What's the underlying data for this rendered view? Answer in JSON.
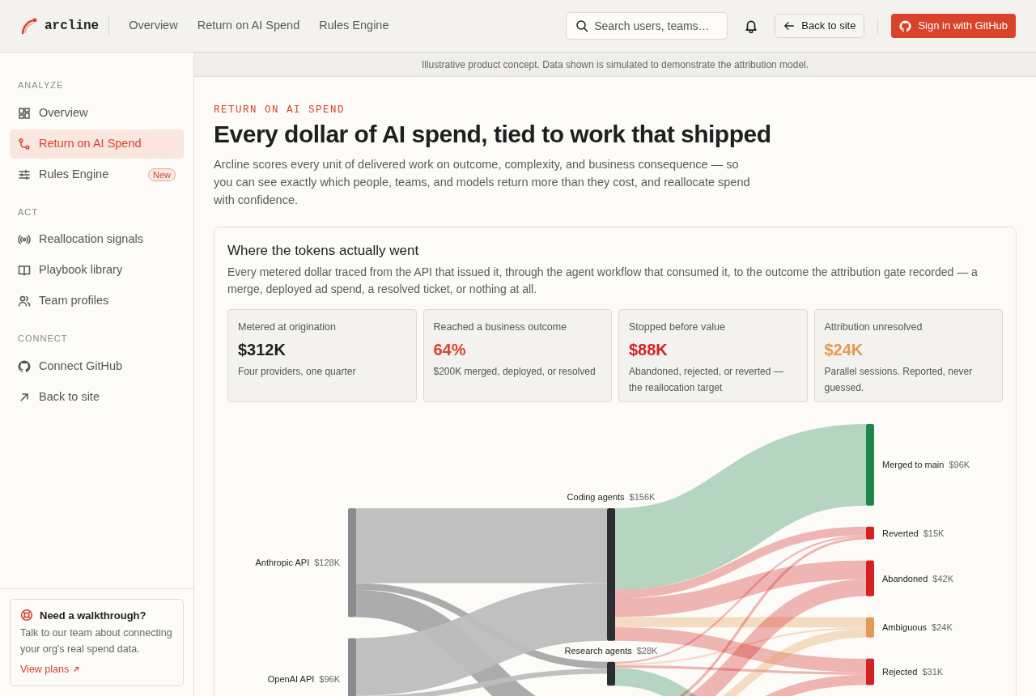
{
  "header": {
    "logo": "arcline",
    "nav": [
      {
        "label": "Overview",
        "selected": false
      },
      {
        "label": "Return on AI Spend",
        "selected": false
      },
      {
        "label": "Rules Engine",
        "selected": false
      }
    ],
    "search": {
      "placeholder": "Search users, teams…"
    },
    "back_button": "Back to site",
    "signin_button": "Sign in with GitHub"
  },
  "sidebar": {
    "sections": [
      {
        "heading": "ANALYZE",
        "items": [
          {
            "label": "Overview",
            "kind": "grid",
            "selected": false
          },
          {
            "label": "Return on AI Spend",
            "kind": "branch",
            "selected": true
          },
          {
            "label": "Rules Engine",
            "kind": "sliders",
            "selected": false,
            "badge": "New"
          }
        ]
      },
      {
        "heading": "ACT",
        "items": [
          {
            "label": "Reallocation signals",
            "kind": "signal",
            "selected": false
          },
          {
            "label": "Playbook library",
            "kind": "book",
            "selected": false
          },
          {
            "label": "Team profiles",
            "kind": "users",
            "selected": false
          }
        ]
      },
      {
        "heading": "CONNECT",
        "items": [
          {
            "label": "Connect GitHub",
            "kind": "github",
            "selected": false
          },
          {
            "label": "Back to site",
            "kind": "arrow",
            "selected": false
          }
        ]
      }
    ],
    "help": {
      "title": "Need a walkthrough?",
      "text": "Talk to our team about connecting your org's real spend data.",
      "link": "View plans"
    }
  },
  "notice": "Illustrative product concept. Data shown is simulated to demonstrate the attribution model.",
  "page": {
    "eyebrow": "RETURN ON AI SPEND",
    "title": "Every dollar of AI spend, tied to work that shipped",
    "lead": "Arcline scores every unit of delivered work on outcome, complexity, and business consequence — so you can see exactly which people, teams, and models return more than they cost, and reallocate spend with confidence."
  },
  "panel": {
    "title": "Where the tokens actually went",
    "description": "Every metered dollar traced from the API that issued it, through the agent workflow that consumed it, to the outcome the attribution gate recorded — a merge, deployed ad spend, a resolved ticket, or nothing at all.",
    "stats": [
      {
        "label": "Metered at origination",
        "value": "$312K",
        "note": "Four providers, one quarter",
        "color": "#1f1f1f"
      },
      {
        "label": "Reached a business outcome",
        "value": "64%",
        "note": "$200K merged, deployed, or resolved",
        "color": "#d9432a"
      },
      {
        "label": "Stopped before value",
        "value": "$88K",
        "note": "Abandoned, rejected, or reverted — the reallocation target",
        "color": "#d42222"
      },
      {
        "label": "Attribution unresolved",
        "value": "$24K",
        "note": "Parallel sessions. Reported, never guessed.",
        "color": "#e39a52"
      }
    ],
    "sankey": {
      "columns": [
        {
          "nodes": [
            {
              "label": "Anthropic API",
              "value": "$128K",
              "color": "#8a8a90"
            },
            {
              "label": "OpenAI API",
              "value": "$96K",
              "color": "#8a8a90"
            }
          ]
        },
        {
          "nodes": [
            {
              "label": "Coding agents",
              "value": "$156K",
              "color": "#2d2e33"
            },
            {
              "label": "Research agents",
              "value": "$28K",
              "color": "#2d2e33"
            }
          ]
        },
        {
          "nodes": [
            {
              "label": "Merged to main",
              "value": "$96K",
              "color": "#1e874b"
            },
            {
              "label": "Reverted",
              "value": "$15K",
              "color": "#d42222"
            },
            {
              "label": "Abandoned",
              "value": "$42K",
              "color": "#d42222"
            },
            {
              "label": "Ambiguous",
              "value": "$24K",
              "color": "#e39a52"
            },
            {
              "label": "Rejected",
              "value": "$31K",
              "color": "#d42222"
            }
          ]
        }
      ]
    }
  }
}
